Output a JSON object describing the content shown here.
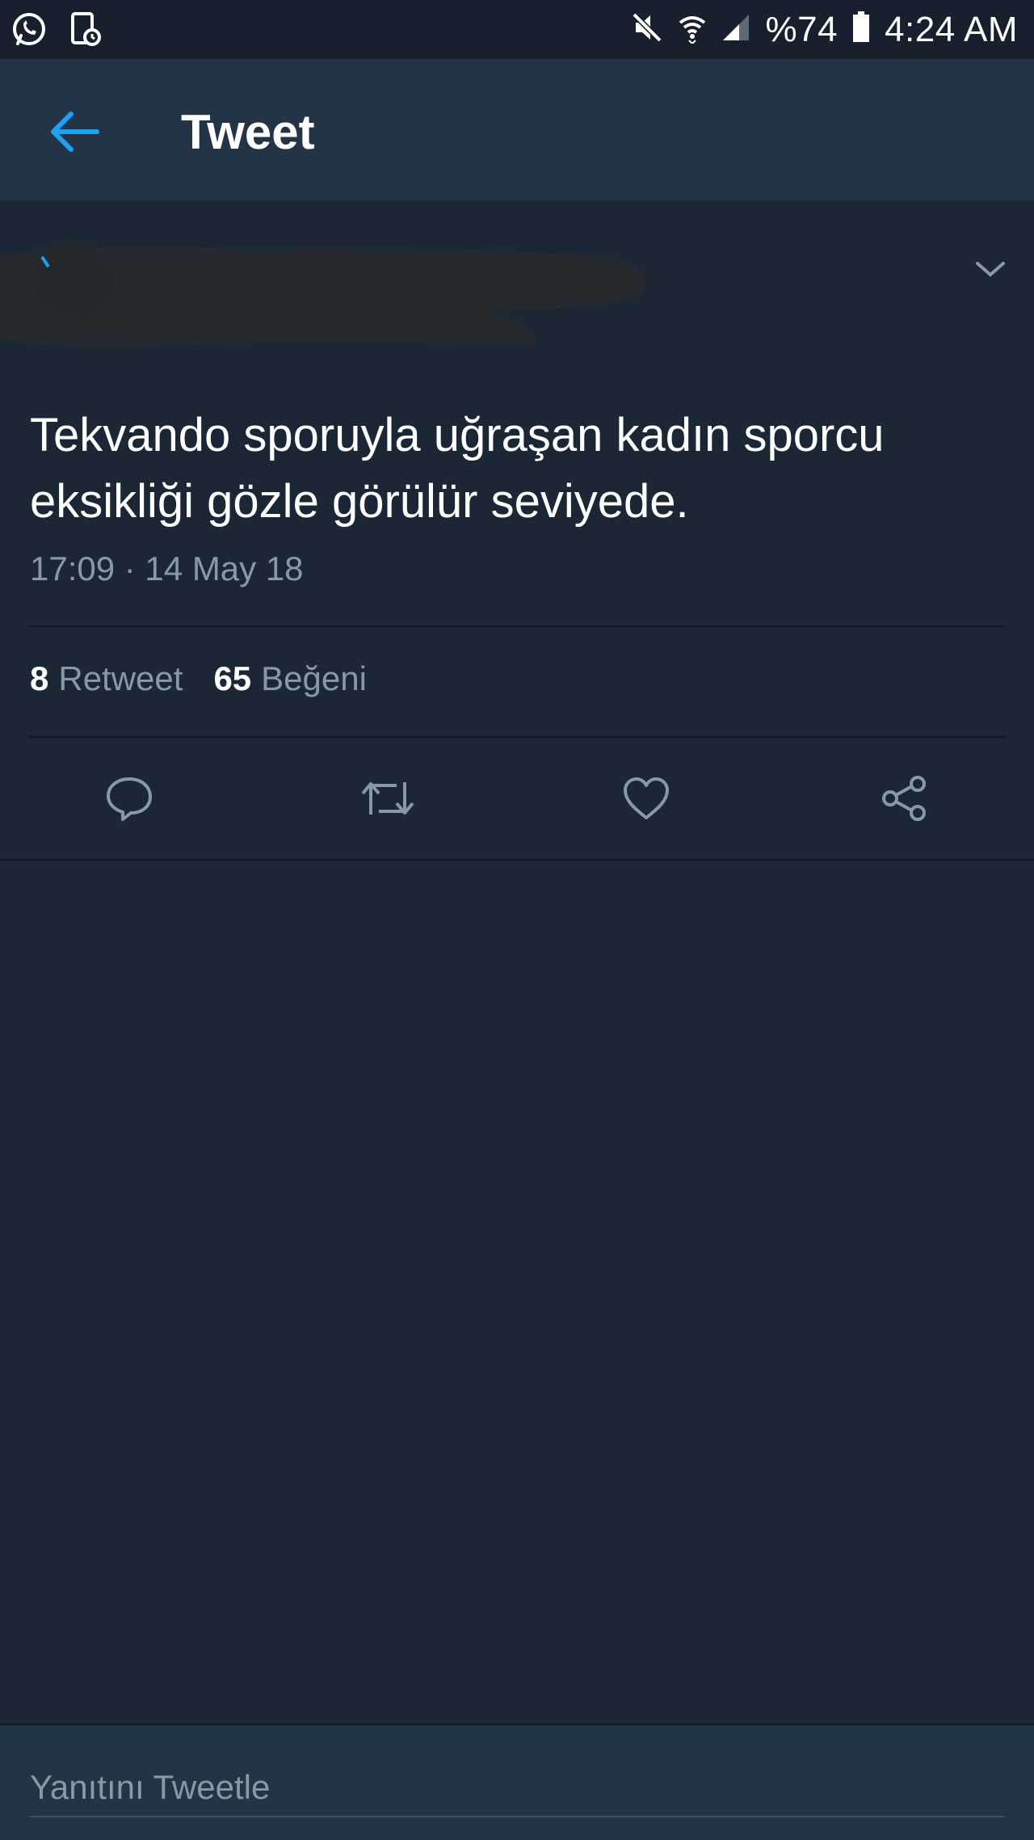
{
  "status_bar": {
    "battery": "%74",
    "time": "4:24 AM"
  },
  "app_bar": {
    "title": "Tweet"
  },
  "tweet": {
    "text": "Tekvando sporuyla uğraşan kadın sporcu eksikliği gözle görülür seviyede.",
    "timestamp": "17:09 · 14 May 18",
    "retweet_count": "8",
    "retweet_label": "Retweet",
    "like_count": "65",
    "like_label": "Beğeni"
  },
  "reply": {
    "placeholder": "Yanıtını Tweetle"
  },
  "colors": {
    "background": "#1c2735",
    "bar": "#243447",
    "accent": "#1da1f2",
    "secondary_text": "#8899a6"
  },
  "icons": {
    "status_left": [
      "whatsapp-icon",
      "notification-icon"
    ],
    "status_right": [
      "mute-icon",
      "wifi-icon",
      "signal-icon",
      "battery-icon"
    ],
    "actions": [
      "reply-icon",
      "retweet-icon",
      "like-icon",
      "share-icon"
    ]
  }
}
